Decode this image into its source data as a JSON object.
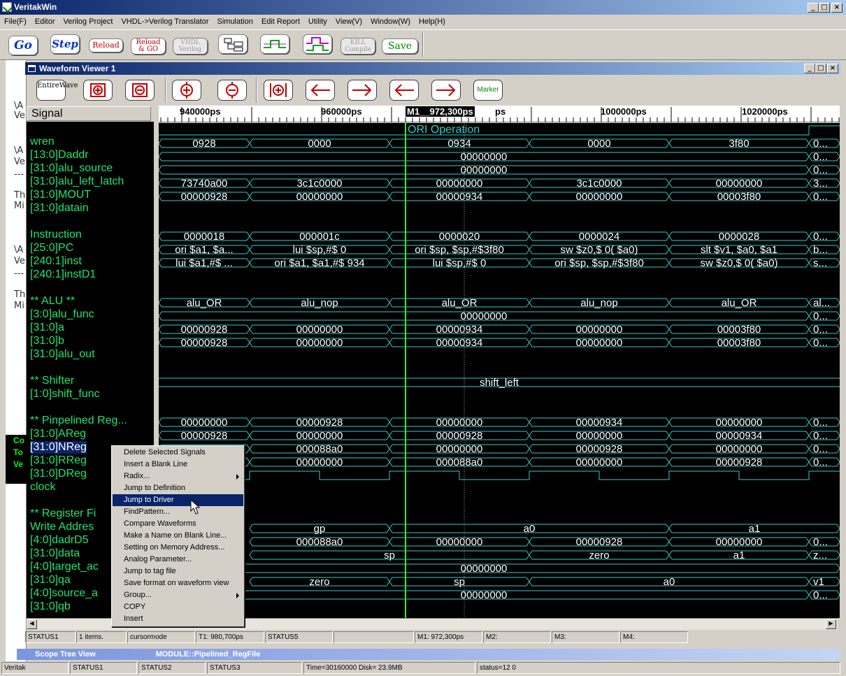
{
  "app": {
    "title": "VeritakWin"
  },
  "menu": [
    "File(F)",
    "Editor",
    "Verilog Project",
    "VHDL->Verilog Translator",
    "Simulation",
    "Edit Report",
    "Utility",
    "View(V)",
    "Window(W)",
    "Help(H)"
  ],
  "toolbar": {
    "go": "Go",
    "step": "Step",
    "reload": "Reload",
    "reload_go_1": "Reload",
    "reload_go_2": "& GO",
    "vhdl_1": "VHDL",
    "vhdl_2": "Verilog",
    "kill_1": "KILL",
    "kill_2": "Compile",
    "save": "Save"
  },
  "left_strip": [
    "\\A",
    "Ve",
    "\\A",
    "Ve",
    "---",
    "Th",
    "Mi",
    "\\A",
    "Ve",
    "---",
    "Th",
    "Mi"
  ],
  "green_box": [
    "Co",
    "To",
    "Ve"
  ],
  "waveform": {
    "title": "Waveform Viewer 1",
    "entire_1": "Entire",
    "entire_2": "Wave",
    "marker": "Marker",
    "signal_header": "Signal",
    "ruler": [
      "940000ps",
      "960000ps",
      "ps",
      "1000000ps",
      "1020000ps"
    ],
    "cursor_label": "M1__972,300ps",
    "annotation": "ORI Operation"
  },
  "signals": [
    "wren",
    "[13:0]Daddr",
    "[31:0]alu_source",
    "[31:0]alu_left_latch",
    "[31:0]MOUT",
    "[31:0]datain",
    "",
    "Instruction",
    "[25:0]PC",
    "[240:1]inst",
    "[240:1]instD1",
    "",
    "** ALU **",
    "[3:0]alu_func",
    "[31:0]a",
    "[31:0]b",
    "[31:0]alu_out",
    "",
    "** Shifter",
    "[1:0]shift_func",
    "",
    "** Pinpelined Reg...",
    "[31:0]AReg",
    "[31:0]NReg",
    "[31:0]RReg",
    "[31:0]DReg",
    "clock",
    "",
    "** Register Fi",
    "Write Addres",
    "[4:0]dadrD5",
    "[31:0]data",
    "[4:0]target_ac",
    "[31:0]qa",
    "[4:0]source_a",
    "[31:0]qb"
  ],
  "rows": [
    {
      "r": 1,
      "cells": [
        [
          "",
          "0928"
        ],
        [
          "",
          "0000"
        ],
        [
          "",
          "0934"
        ],
        [
          "",
          "0000"
        ],
        [
          "",
          "3f80"
        ],
        [
          "",
          "0..."
        ]
      ]
    },
    {
      "r": 2,
      "cells": [
        [
          "full",
          "00000000"
        ],
        [
          "tail",
          "0..."
        ]
      ]
    },
    {
      "r": 3,
      "cells": [
        [
          "full",
          "00000000"
        ],
        [
          "tail",
          "0..."
        ]
      ]
    },
    {
      "r": 4,
      "cells": [
        [
          "",
          "73740a00"
        ],
        [
          "",
          "3c1c0000"
        ],
        [
          "",
          "00000000"
        ],
        [
          "",
          "3c1c0000"
        ],
        [
          "",
          "00000000"
        ],
        [
          "",
          "3..."
        ]
      ]
    },
    {
      "r": 5,
      "cells": [
        [
          "",
          "00000928"
        ],
        [
          "",
          "00000000"
        ],
        [
          "",
          "00000934"
        ],
        [
          "",
          "00000000"
        ],
        [
          "",
          "00003f80"
        ],
        [
          "",
          "0..."
        ]
      ]
    },
    {
      "r": 8,
      "cells": [
        [
          "",
          "0000018"
        ],
        [
          "",
          "000001c"
        ],
        [
          "",
          "0000020"
        ],
        [
          "",
          "0000024"
        ],
        [
          "",
          "0000028"
        ],
        [
          "",
          "0..."
        ]
      ]
    },
    {
      "r": 9,
      "cells": [
        [
          "",
          "ori  $a1, $a..."
        ],
        [
          "",
          "lui  $sp,#$   0"
        ],
        [
          "",
          "ori  $sp, $sp,#$3f80"
        ],
        [
          "",
          "sw  $z0,$   0( $a0)"
        ],
        [
          "",
          "slt  $v1, $a0, $a1"
        ],
        [
          "",
          "b..."
        ]
      ]
    },
    {
      "r": 10,
      "cells": [
        [
          "",
          "lui  $a1,#$ ..."
        ],
        [
          "",
          "ori  $a1, $a1,#$ 934"
        ],
        [
          "",
          "lui  $sp,#$   0"
        ],
        [
          "",
          "ori  $sp, $sp,#$3f80"
        ],
        [
          "",
          "sw  $z0,$   0( $a0)"
        ],
        [
          "",
          "s..."
        ]
      ]
    },
    {
      "r": 13,
      "cells": [
        [
          "",
          "alu_OR"
        ],
        [
          "",
          "alu_nop"
        ],
        [
          "",
          "alu_OR"
        ],
        [
          "",
          "alu_nop"
        ],
        [
          "",
          "alu_OR"
        ],
        [
          "",
          "al..."
        ]
      ]
    },
    {
      "r": 14,
      "cells": [
        [
          "full",
          "00000000"
        ],
        [
          "tail",
          "0..."
        ]
      ]
    },
    {
      "r": 15,
      "cells": [
        [
          "",
          "00000928"
        ],
        [
          "",
          "00000000"
        ],
        [
          "",
          "00000934"
        ],
        [
          "",
          "00000000"
        ],
        [
          "",
          "00003f80"
        ],
        [
          "",
          "0..."
        ]
      ]
    },
    {
      "r": 16,
      "cells": [
        [
          "",
          "00000928"
        ],
        [
          "",
          "00000000"
        ],
        [
          "",
          "00000934"
        ],
        [
          "",
          "00000000"
        ],
        [
          "",
          "00003f80"
        ],
        [
          "",
          "0..."
        ]
      ]
    },
    {
      "r": 19,
      "cells": [
        [
          "wide",
          "shift_left"
        ]
      ]
    },
    {
      "r": 22,
      "cells": [
        [
          "",
          "00000000"
        ],
        [
          "",
          "00000928"
        ],
        [
          "",
          "00000000"
        ],
        [
          "",
          "00000934"
        ],
        [
          "",
          "00000000"
        ],
        [
          "",
          "0..."
        ]
      ]
    },
    {
      "r": 23,
      "cells": [
        [
          "",
          "00000928"
        ],
        [
          "",
          "00000000"
        ],
        [
          "",
          "00000928"
        ],
        [
          "",
          "00000000"
        ],
        [
          "",
          "00000934"
        ],
        [
          "",
          "0..."
        ]
      ]
    },
    {
      "r": 24,
      "cells": [
        [
          "",
          "00000000"
        ],
        [
          "",
          "000088a0"
        ],
        [
          "",
          "00000000"
        ],
        [
          "",
          "00000928"
        ],
        [
          "",
          "00000000"
        ],
        [
          "",
          "0..."
        ]
      ]
    },
    {
      "r": 25,
      "cells": [
        [
          "",
          "00000000"
        ],
        [
          "",
          "00000000"
        ],
        [
          "",
          "000088a0"
        ],
        [
          "",
          "00000000"
        ],
        [
          "",
          "00000928"
        ],
        [
          "",
          "0..."
        ]
      ]
    },
    {
      "r": 30,
      "cells": [
        [
          "",
          "gp"
        ],
        [
          "",
          "a0"
        ],
        [
          "",
          "a1"
        ]
      ]
    },
    {
      "r": 31,
      "cells": [
        [
          "",
          "000088a0"
        ],
        [
          "",
          "00000000"
        ],
        [
          "",
          "00000928"
        ],
        [
          "",
          "00000000"
        ],
        [
          "",
          "0..."
        ]
      ]
    },
    {
      "r": 32,
      "cells": [
        [
          "",
          "sp"
        ],
        [
          "",
          "zero"
        ],
        [
          "",
          "a1"
        ],
        [
          "",
          "z..."
        ]
      ]
    },
    {
      "r": 33,
      "cells": [
        [
          "full",
          "00000000"
        ]
      ]
    },
    {
      "r": 34,
      "cells": [
        [
          "",
          "zero"
        ],
        [
          "",
          "sp"
        ],
        [
          "",
          "a0"
        ],
        [
          "",
          "v1"
        ]
      ]
    },
    {
      "r": 35,
      "cells": [
        [
          "full",
          "00000000"
        ],
        [
          "tail",
          "0..."
        ]
      ]
    }
  ],
  "context_menu": [
    "Delete Selected Signals",
    "Insert a Blank Line",
    "Radix...",
    "Jump to Definition",
    "Jump to Driver",
    "FindPattern...",
    "Compare Waveforms",
    "Make a Name on Blank Line...",
    "Setting on Memory Address...",
    "Analog Parameter...",
    "Jump to tag file",
    "Save format on waveform view",
    "Group...",
    "COPY",
    "Insert"
  ],
  "wv_status": [
    "STATUS1",
    "1 items.",
    "cursormode",
    "T1: 980,700ps",
    "STATUS5",
    "",
    "M1: 972,300ps",
    "M2:",
    "M3:",
    "M4:"
  ],
  "scope": {
    "title": "Scope Tree View",
    "module": "MODULE::Pipelined_RegFile"
  },
  "app_status": [
    "Veritak",
    "STATUS1",
    "STATUS2",
    "STATUS3",
    "Time=30160000 Disk= 23.9MB",
    "status=12 0"
  ],
  "colors": {
    "wave": "#33cccc",
    "text": "#ffffff",
    "signal": "#1ce66e",
    "cursor": "#33ee33",
    "titlebar": "#0a246a"
  }
}
